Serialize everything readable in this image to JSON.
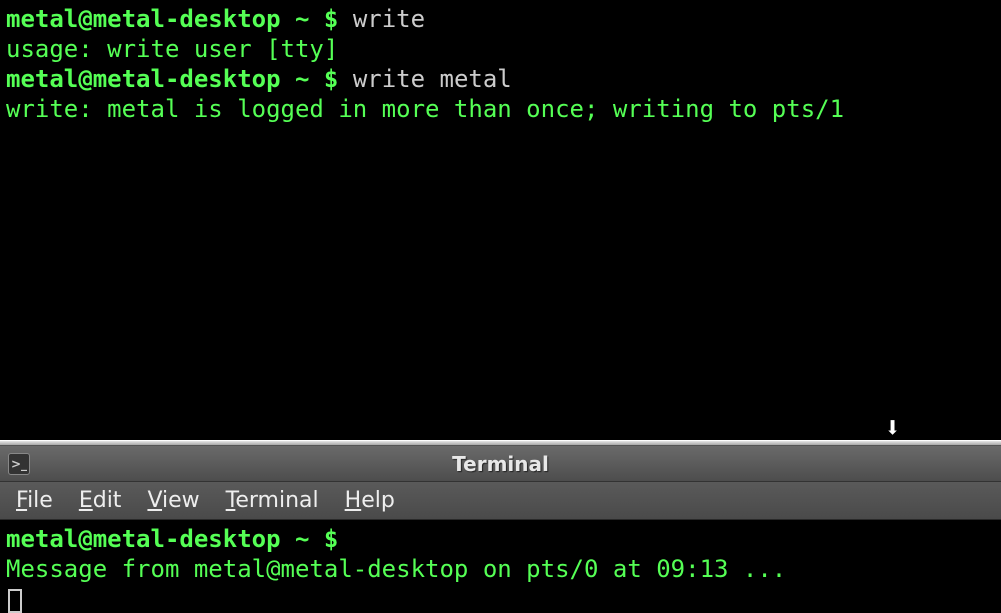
{
  "top_terminal": {
    "lines": [
      {
        "prompt_user": "metal@metal-desktop",
        "prompt_path": "~",
        "prompt_symbol": "$",
        "command": "write"
      },
      {
        "output": "usage: write user [tty]"
      },
      {
        "prompt_user": "metal@metal-desktop",
        "prompt_path": "~",
        "prompt_symbol": "$",
        "command": "write metal"
      },
      {
        "output": "write: metal is logged in more than once; writing to pts/1"
      }
    ]
  },
  "window": {
    "title": "Terminal",
    "icon_label": ">_"
  },
  "menubar": {
    "file": "File",
    "edit": "Edit",
    "view": "View",
    "terminal": "Terminal",
    "help": "Help"
  },
  "bottom_terminal": {
    "line1": {
      "prompt_user": "metal@metal-desktop",
      "prompt_path": "~",
      "prompt_symbol": "$",
      "command": ""
    },
    "line2": {
      "output": "Message from metal@metal-desktop on pts/0 at 09:13 ..."
    }
  },
  "icons": {
    "download": "⬇"
  }
}
